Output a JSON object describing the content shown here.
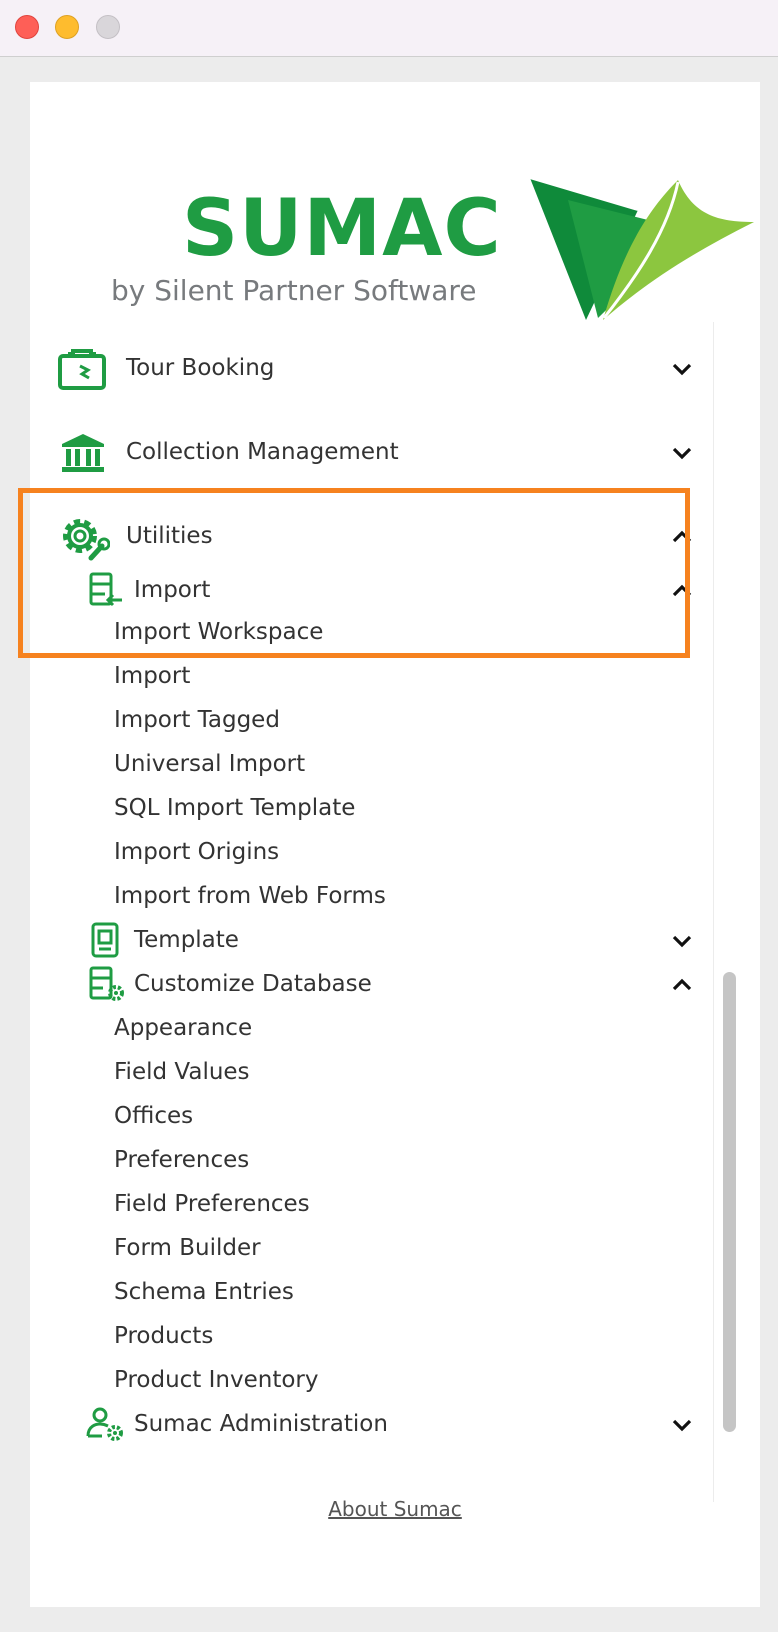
{
  "window": {
    "controls": [
      "close",
      "minimize",
      "zoom"
    ]
  },
  "brand": {
    "name": "SUMAC",
    "tagline": "by Silent Partner Software",
    "colors": {
      "green": "#1f9c43",
      "leaf_light": "#8cc63f",
      "leaf_dark": "#0f8a3a",
      "highlight": "#f6821f"
    }
  },
  "menu": {
    "tour_booking": {
      "label": "Tour Booking",
      "icon": "suitcase-icon",
      "state": "collapsed"
    },
    "collection_management": {
      "label": "Collection Management",
      "icon": "museum-icon",
      "state": "collapsed"
    },
    "utilities": {
      "label": "Utilities",
      "icon": "gear-wrench-icon",
      "state": "expanded",
      "import": {
        "label": "Import",
        "icon": "import-icon",
        "state": "expanded",
        "items": [
          "Import Workspace",
          "Import",
          "Import Tagged",
          "Universal Import",
          "SQL Import Template",
          "Import Origins",
          "Import from Web Forms"
        ]
      },
      "template": {
        "label": "Template",
        "icon": "template-icon",
        "state": "collapsed"
      },
      "customize_database": {
        "label": "Customize Database",
        "icon": "database-gear-icon",
        "state": "expanded",
        "items": [
          "Appearance",
          "Field Values",
          "Offices",
          "Preferences",
          "Field Preferences",
          "Form Builder",
          "Schema Entries",
          "Products",
          "Product Inventory"
        ]
      },
      "sumac_administration": {
        "label": "Sumac Administration",
        "icon": "user-gear-icon",
        "state": "collapsed"
      }
    }
  },
  "footer": {
    "about_link": "About Sumac"
  }
}
